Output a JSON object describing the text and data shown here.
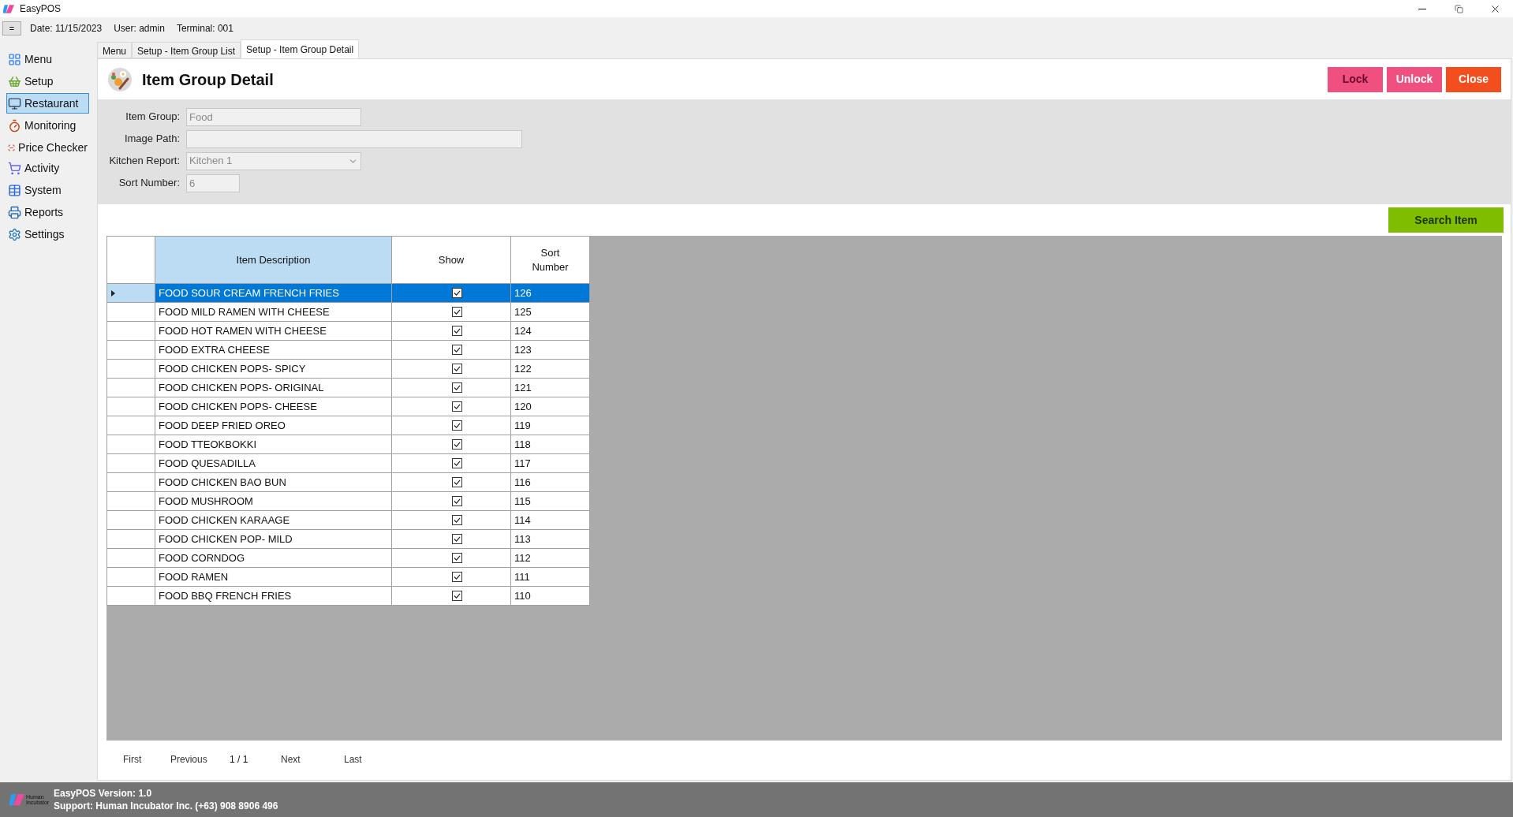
{
  "window": {
    "title": "EasyPOS"
  },
  "header": {
    "menu_button": "=",
    "date": "Date: 11/15/2023",
    "user": "User: admin",
    "terminal": "Terminal: 001"
  },
  "tabs": [
    {
      "label": "Menu",
      "selected": false
    },
    {
      "label": "Setup - Item Group List",
      "selected": false
    },
    {
      "label": "Setup - Item Group Detail",
      "selected": true
    }
  ],
  "sidebar": {
    "items": [
      {
        "label": "Menu",
        "selected": false
      },
      {
        "label": "Setup",
        "selected": false
      },
      {
        "label": "Restaurant",
        "selected": true
      },
      {
        "label": "Monitoring",
        "selected": false
      },
      {
        "label": "Price Checker",
        "selected": false
      },
      {
        "label": "Activity",
        "selected": false
      },
      {
        "label": "System",
        "selected": false
      },
      {
        "label": "Reports",
        "selected": false
      },
      {
        "label": "Settings",
        "selected": false
      }
    ]
  },
  "page": {
    "title": "Item Group Detail",
    "buttons": [
      {
        "label": "Lock",
        "kind": "lock"
      },
      {
        "label": "Unlock",
        "kind": "unlock"
      },
      {
        "label": "Close",
        "kind": "close"
      }
    ]
  },
  "form": {
    "fields": [
      {
        "label": "Item Group:",
        "value": "Food",
        "kind": "text"
      },
      {
        "label": "Image Path:",
        "kind": "wide"
      },
      {
        "label": "Kitchen Report:",
        "value": "Kitchen 1",
        "kind": "select"
      },
      {
        "label": "Sort Number:",
        "value": "6",
        "kind": "short"
      }
    ]
  },
  "search_button": "Search Item",
  "table": {
    "columns": [
      "Item Description",
      "Show",
      "Sort Number"
    ],
    "rows": [
      {
        "description": "FOOD SOUR CREAM FRENCH FRIES",
        "show": true,
        "sort": "126",
        "selected": true
      },
      {
        "description": "FOOD MILD RAMEN WITH CHEESE",
        "show": true,
        "sort": "125",
        "selected": false
      },
      {
        "description": "FOOD HOT RAMEN WITH CHEESE",
        "show": true,
        "sort": "124",
        "selected": false
      },
      {
        "description": "FOOD EXTRA CHEESE",
        "show": true,
        "sort": "123",
        "selected": false
      },
      {
        "description": "FOOD CHICKEN POPS- SPICY",
        "show": true,
        "sort": "122",
        "selected": false
      },
      {
        "description": "FOOD CHICKEN POPS- ORIGINAL",
        "show": true,
        "sort": "121",
        "selected": false
      },
      {
        "description": "FOOD CHICKEN POPS- CHEESE",
        "show": true,
        "sort": "120",
        "selected": false
      },
      {
        "description": "FOOD DEEP FRIED OREO",
        "show": true,
        "sort": "119",
        "selected": false
      },
      {
        "description": "FOOD TTEOKBOKKI",
        "show": true,
        "sort": "118",
        "selected": false
      },
      {
        "description": "FOOD QUESADILLA",
        "show": true,
        "sort": "117",
        "selected": false
      },
      {
        "description": "FOOD CHICKEN BAO BUN",
        "show": true,
        "sort": "116",
        "selected": false
      },
      {
        "description": "FOOD MUSHROOM",
        "show": true,
        "sort": "115",
        "selected": false
      },
      {
        "description": "FOOD CHICKEN KARAAGE",
        "show": true,
        "sort": "114",
        "selected": false
      },
      {
        "description": "FOOD CHICKEN POP- MILD",
        "show": true,
        "sort": "113",
        "selected": false
      },
      {
        "description": "FOOD CORNDOG",
        "show": true,
        "sort": "112",
        "selected": false
      },
      {
        "description": "FOOD RAMEN",
        "show": true,
        "sort": "111",
        "selected": false
      },
      {
        "description": "FOOD BBQ FRENCH FRIES",
        "show": true,
        "sort": "110",
        "selected": false
      }
    ]
  },
  "pager": {
    "first": "First",
    "previous": "Previous",
    "page": "1 / 1",
    "next": "Next",
    "last": "Last"
  },
  "footer": {
    "logo_text": "Human Incubator",
    "version": "EasyPOS Version: 1.0",
    "support": "Support: Human Incubator Inc. (+63) 908 8906 496"
  }
}
